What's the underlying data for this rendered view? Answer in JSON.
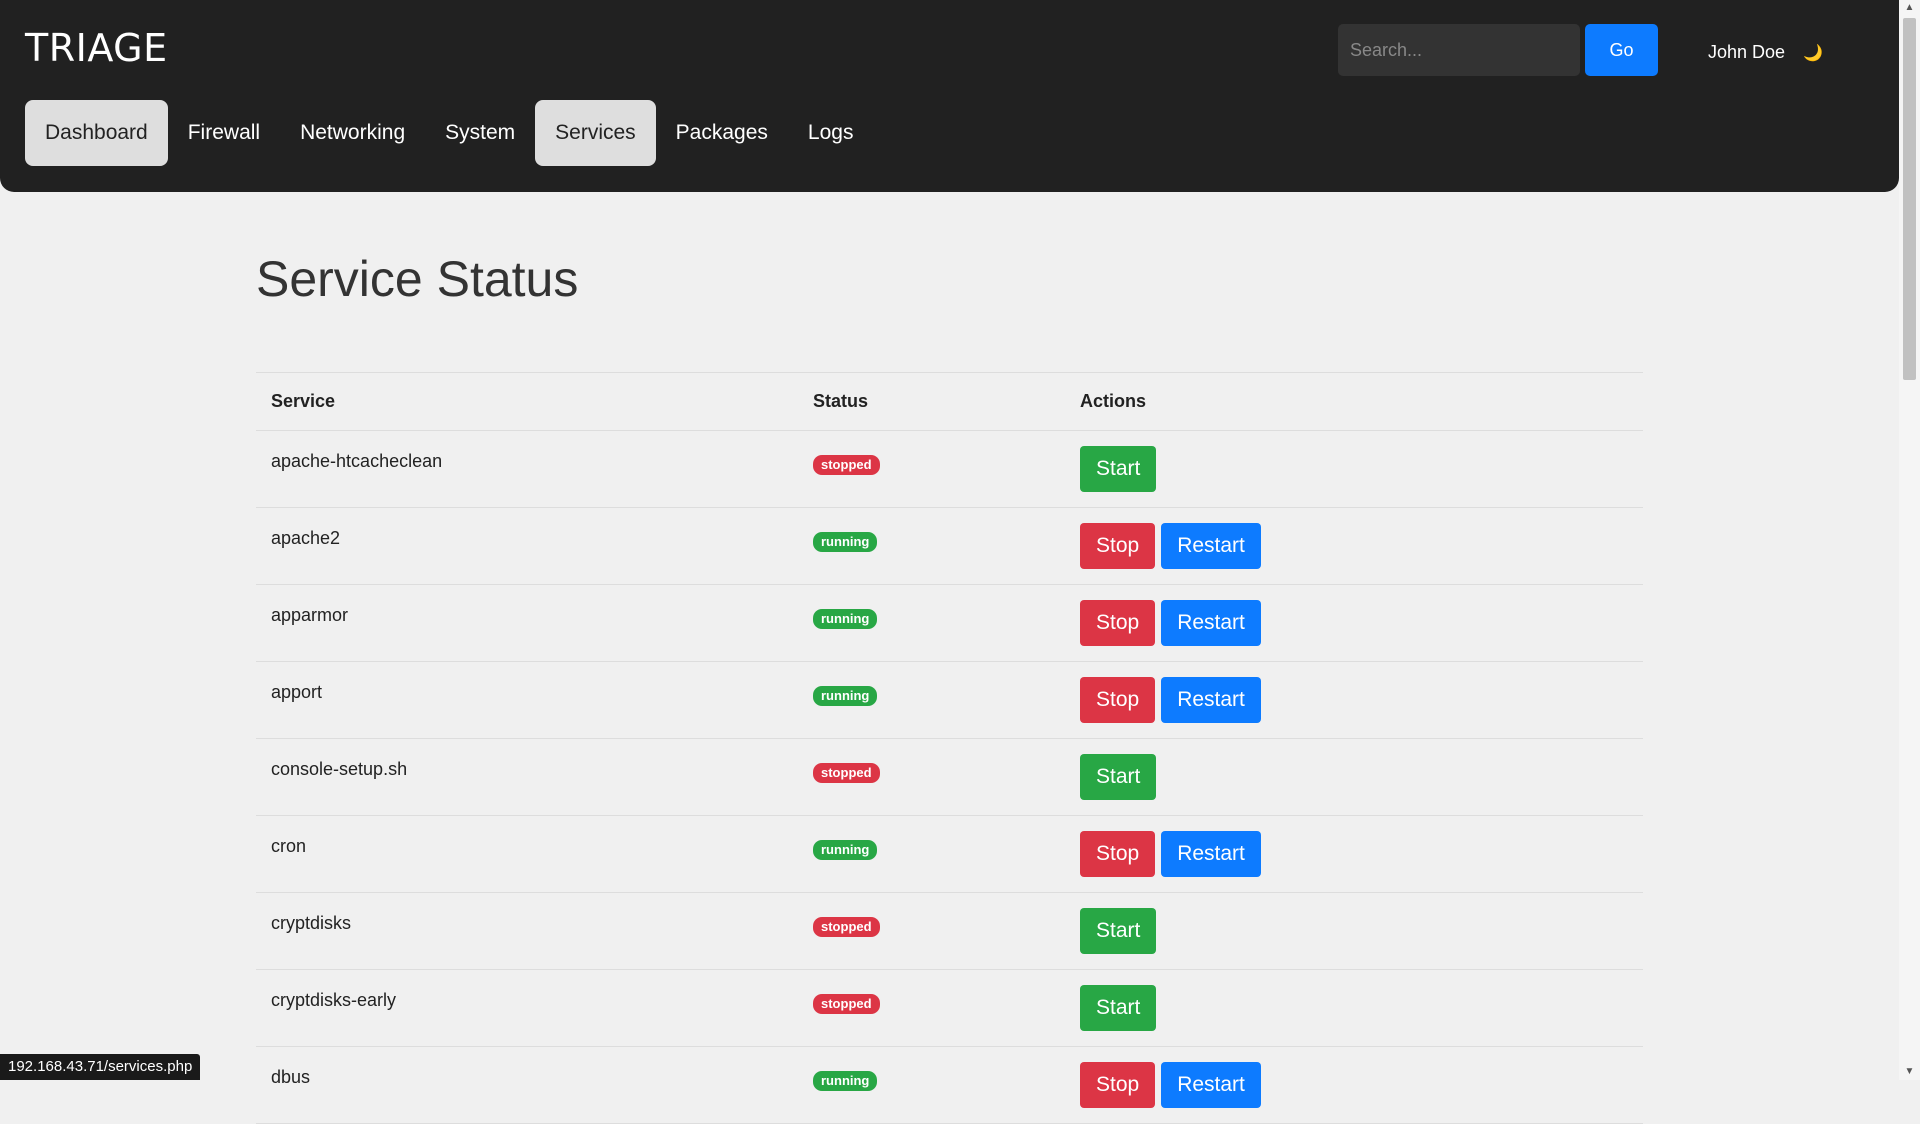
{
  "header": {
    "logo": "TRIAGE",
    "search": {
      "placeholder": "Search...",
      "value": ""
    },
    "go_label": "Go",
    "user_name": "John Doe",
    "theme_icon": "🌙"
  },
  "nav": {
    "items": [
      {
        "label": "Dashboard",
        "active": true
      },
      {
        "label": "Firewall",
        "active": false
      },
      {
        "label": "Networking",
        "active": false
      },
      {
        "label": "System",
        "active": false
      },
      {
        "label": "Services",
        "active": true
      },
      {
        "label": "Packages",
        "active": false
      },
      {
        "label": "Logs",
        "active": false
      }
    ]
  },
  "main": {
    "title": "Service Status",
    "columns": [
      "Service",
      "Status",
      "Actions"
    ],
    "rows": [
      {
        "service": "apache-htcacheclean",
        "status": "stopped"
      },
      {
        "service": "apache2",
        "status": "running"
      },
      {
        "service": "apparmor",
        "status": "running"
      },
      {
        "service": "apport",
        "status": "running"
      },
      {
        "service": "console-setup.sh",
        "status": "stopped"
      },
      {
        "service": "cron",
        "status": "running"
      },
      {
        "service": "cryptdisks",
        "status": "stopped"
      },
      {
        "service": "cryptdisks-early",
        "status": "stopped"
      },
      {
        "service": "dbus",
        "status": "running"
      }
    ],
    "actions": {
      "start": "Start",
      "stop": "Stop",
      "restart": "Restart"
    }
  },
  "statusbar": {
    "url": "192.168.43.71/services.php"
  },
  "colors": {
    "header_bg": "#212121",
    "start": "#28a745",
    "stop": "#dc3545",
    "restart": "#0d7bff",
    "page_bg": "#f0f0f0"
  }
}
